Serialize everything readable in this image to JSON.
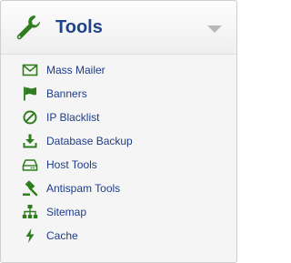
{
  "panel": {
    "title": "Tools",
    "header_icon": "wrench-icon",
    "toggle_icon": "chevron-down-icon"
  },
  "colors": {
    "icon_green": "#2f7d1f",
    "title_blue": "#20438a",
    "link_blue": "#1f3c88",
    "toggle_gray": "#b8b8b8"
  },
  "menu": {
    "items": [
      {
        "label": "Mass Mailer",
        "icon": "envelope-icon"
      },
      {
        "label": "Banners",
        "icon": "flag-icon"
      },
      {
        "label": "IP Blacklist",
        "icon": "ban-icon"
      },
      {
        "label": "Database Backup",
        "icon": "download-icon"
      },
      {
        "label": "Host Tools",
        "icon": "hdd-icon"
      },
      {
        "label": "Antispam Tools",
        "icon": "gavel-icon"
      },
      {
        "label": "Sitemap",
        "icon": "sitemap-icon"
      },
      {
        "label": "Cache",
        "icon": "bolt-icon"
      }
    ]
  }
}
